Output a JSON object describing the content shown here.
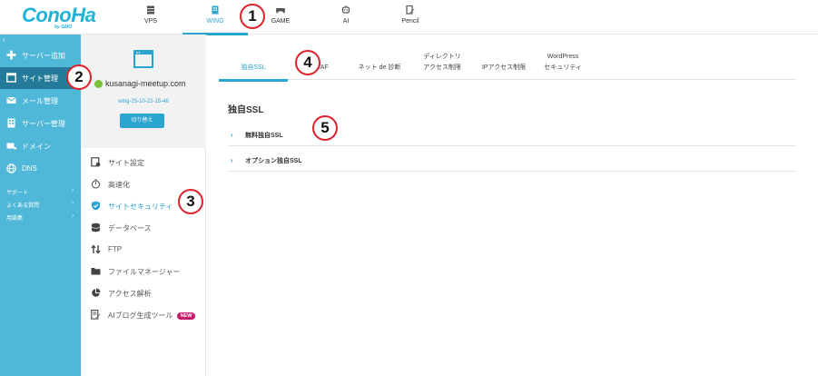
{
  "brand": {
    "logo_text": "ConoHa",
    "logo_sub": "by GMO"
  },
  "topnav": [
    {
      "label": "VPS",
      "icon": "server-icon"
    },
    {
      "label": "WING",
      "icon": "building-icon",
      "active": true
    },
    {
      "label": "GAME",
      "icon": "gamepad-icon"
    },
    {
      "label": "AI",
      "icon": "ai-chip-icon"
    },
    {
      "label": "Pencil",
      "icon": "pencil-doc-icon"
    }
  ],
  "annotations": [
    "1",
    "2",
    "3",
    "4",
    "5"
  ],
  "sidebar": {
    "toggle": "‹",
    "items": [
      {
        "label": "サーバー追加",
        "icon": "plus-icon"
      },
      {
        "label": "サイト管理",
        "icon": "window-icon",
        "active": true
      },
      {
        "label": "メール管理",
        "icon": "mail-icon"
      },
      {
        "label": "サーバー管理",
        "icon": "building-icon"
      },
      {
        "label": "ドメイン",
        "icon": "domain-icon"
      },
      {
        "label": "DNS",
        "icon": "globe-icon"
      }
    ],
    "links": [
      {
        "label": "サポート",
        "chevron": "›"
      },
      {
        "label": "よくある質問",
        "chevron": "›"
      },
      {
        "label": "用語集",
        "chevron": "›"
      }
    ]
  },
  "server": {
    "name": "kusanagi-meetup.com",
    "id": "wing-25-10-22-15-46",
    "switch_label": "切り替え"
  },
  "submenu": [
    {
      "label": "サイト設定",
      "icon": "settings-page-icon"
    },
    {
      "label": "高速化",
      "icon": "stopwatch-icon"
    },
    {
      "label": "サイトセキュリティ",
      "icon": "shield-check-icon",
      "active": true
    },
    {
      "label": "データベース",
      "icon": "database-icon"
    },
    {
      "label": "FTP",
      "icon": "transfer-arrows-icon"
    },
    {
      "label": "ファイルマネージャー",
      "icon": "folder-icon"
    },
    {
      "label": "アクセス解析",
      "icon": "pie-chart-icon"
    },
    {
      "label": "AIブログ生成ツール",
      "icon": "ai-doc-icon",
      "badge": "NEW"
    }
  ],
  "tabs": [
    {
      "lines": [
        "独自SSL"
      ],
      "active": true
    },
    {
      "lines": [
        "WAF"
      ]
    },
    {
      "lines": [
        "ネット de 診断"
      ]
    },
    {
      "lines": [
        "ディレクトリ",
        "アクセス制限"
      ]
    },
    {
      "lines": [
        "IPアクセス制限"
      ]
    },
    {
      "lines": [
        "WordPress",
        "セキュリティ"
      ]
    }
  ],
  "section": {
    "title": "独自SSL",
    "rows": [
      {
        "label": "無料独自SSL",
        "chevron": "›"
      },
      {
        "label": "オプション独自SSL",
        "chevron": "›"
      }
    ]
  },
  "colors": {
    "accent": "#2aa5cf",
    "sidebar": "#4fb8d8",
    "sidebar_active": "#237a99",
    "annotation": "#e0202a",
    "new_badge": "#c61a6b"
  }
}
